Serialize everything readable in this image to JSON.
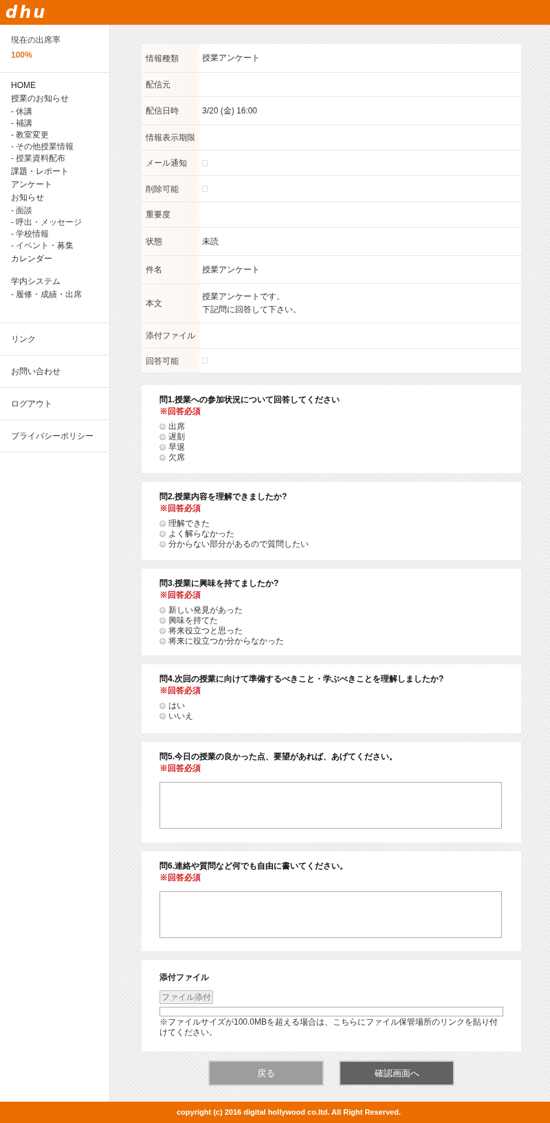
{
  "header": {
    "logo": "dhu"
  },
  "sidebar": {
    "attendance": {
      "label": "現在の出席率",
      "value": "100%"
    },
    "nav": [
      {
        "label": "HOME"
      },
      {
        "label": "授業のお知らせ",
        "children": [
          {
            "label": "- 休講"
          },
          {
            "label": "- 補講"
          },
          {
            "label": "- 教室変更"
          },
          {
            "label": "- その他授業情報"
          },
          {
            "label": "- 授業資料配布"
          }
        ]
      },
      {
        "label": "課題・レポート"
      },
      {
        "label": "アンケート"
      },
      {
        "label": "お知らせ",
        "children": [
          {
            "label": "- 面談"
          },
          {
            "label": "- 呼出・メッセージ"
          },
          {
            "label": "- 学校情報"
          },
          {
            "label": "- イベント・募集"
          }
        ]
      },
      {
        "label": "カレンダー"
      },
      {
        "label": "学内システム",
        "children": [
          {
            "label": "- 履修・成績・出席"
          }
        ]
      }
    ],
    "links": [
      "リンク",
      "お問い合わせ",
      "ログアウト",
      "プライバシーポリシー"
    ]
  },
  "details": [
    {
      "label": "情報種類",
      "kind": "text",
      "value": [
        "授業アンケート"
      ]
    },
    {
      "label": "配信元",
      "kind": "empty"
    },
    {
      "label": "配信日時",
      "kind": "text",
      "value": [
        "3/20 (金) 16:00"
      ]
    },
    {
      "label": "情報表示期限",
      "kind": "empty"
    },
    {
      "label": "メール通知",
      "kind": "checkbox",
      "checked": false
    },
    {
      "label": "削除可能",
      "kind": "checkbox",
      "checked": false
    },
    {
      "label": "重要度",
      "kind": "empty"
    },
    {
      "label": "状態",
      "kind": "text",
      "value": [
        "未読"
      ]
    },
    {
      "label": "件名",
      "kind": "text",
      "value": [
        "授業アンケート"
      ]
    },
    {
      "label": "本文",
      "kind": "text",
      "value": [
        "授業アンケートです。",
        "下記問に回答して下さい。"
      ]
    },
    {
      "label": "添付ファイル",
      "kind": "empty"
    },
    {
      "label": "回答可能",
      "kind": "checkbox",
      "checked": false
    }
  ],
  "questions": [
    {
      "title": "問1.授業への参加状況について回答してください",
      "required": "※回答必須",
      "kind": "radio",
      "options": [
        {
          "label": "出席",
          "selected": false
        },
        {
          "label": "遅刻",
          "selected": false
        },
        {
          "label": "早退",
          "selected": false
        },
        {
          "label": "欠席",
          "selected": false
        }
      ]
    },
    {
      "title": "問2.授業内容を理解できましたか?",
      "required": "※回答必須",
      "kind": "radio",
      "options": [
        {
          "label": "理解できた",
          "selected": false
        },
        {
          "label": "よく解らなかった",
          "selected": false
        },
        {
          "label": "分からない部分があるので質問したい",
          "selected": false
        }
      ]
    },
    {
      "title": "問3.授業に興味を持てましたか?",
      "required": "※回答必須",
      "kind": "radio",
      "options": [
        {
          "label": "新しい発見があった",
          "selected": false
        },
        {
          "label": "興味を持てた",
          "selected": false
        },
        {
          "label": "将来役立つと思った",
          "selected": false
        },
        {
          "label": "将来に役立つか分からなかった",
          "selected": false
        }
      ]
    },
    {
      "title": "問4.次回の授業に向けて準備するべきこと・学ぶべきことを理解しましたか?",
      "required": "※回答必須",
      "kind": "radio",
      "options": [
        {
          "label": "はい",
          "selected": false
        },
        {
          "label": "いいえ",
          "selected": false
        }
      ]
    },
    {
      "title": "問5.今日の授業の良かった点、要望があれば、あげてください。",
      "required": "※回答必須",
      "kind": "textarea"
    },
    {
      "title": "問6.連絡や質問など何でも自由に書いてください。",
      "required": "※回答必須",
      "kind": "textarea"
    }
  ],
  "attachment": {
    "title": "添付ファイル",
    "button": "ファイル添付",
    "note": "※ファイルサイズが100.0MBを超える場合は、こちらにファイル保管場所のリンクを貼り付けてください。"
  },
  "buttons": [
    {
      "label": "戻る",
      "kind": "back"
    },
    {
      "label": "確認画面へ",
      "kind": "confirm"
    }
  ],
  "footer": {
    "text": "copyright (c) 2016 digital hollywood co.ltd. All Right Reserved."
  }
}
